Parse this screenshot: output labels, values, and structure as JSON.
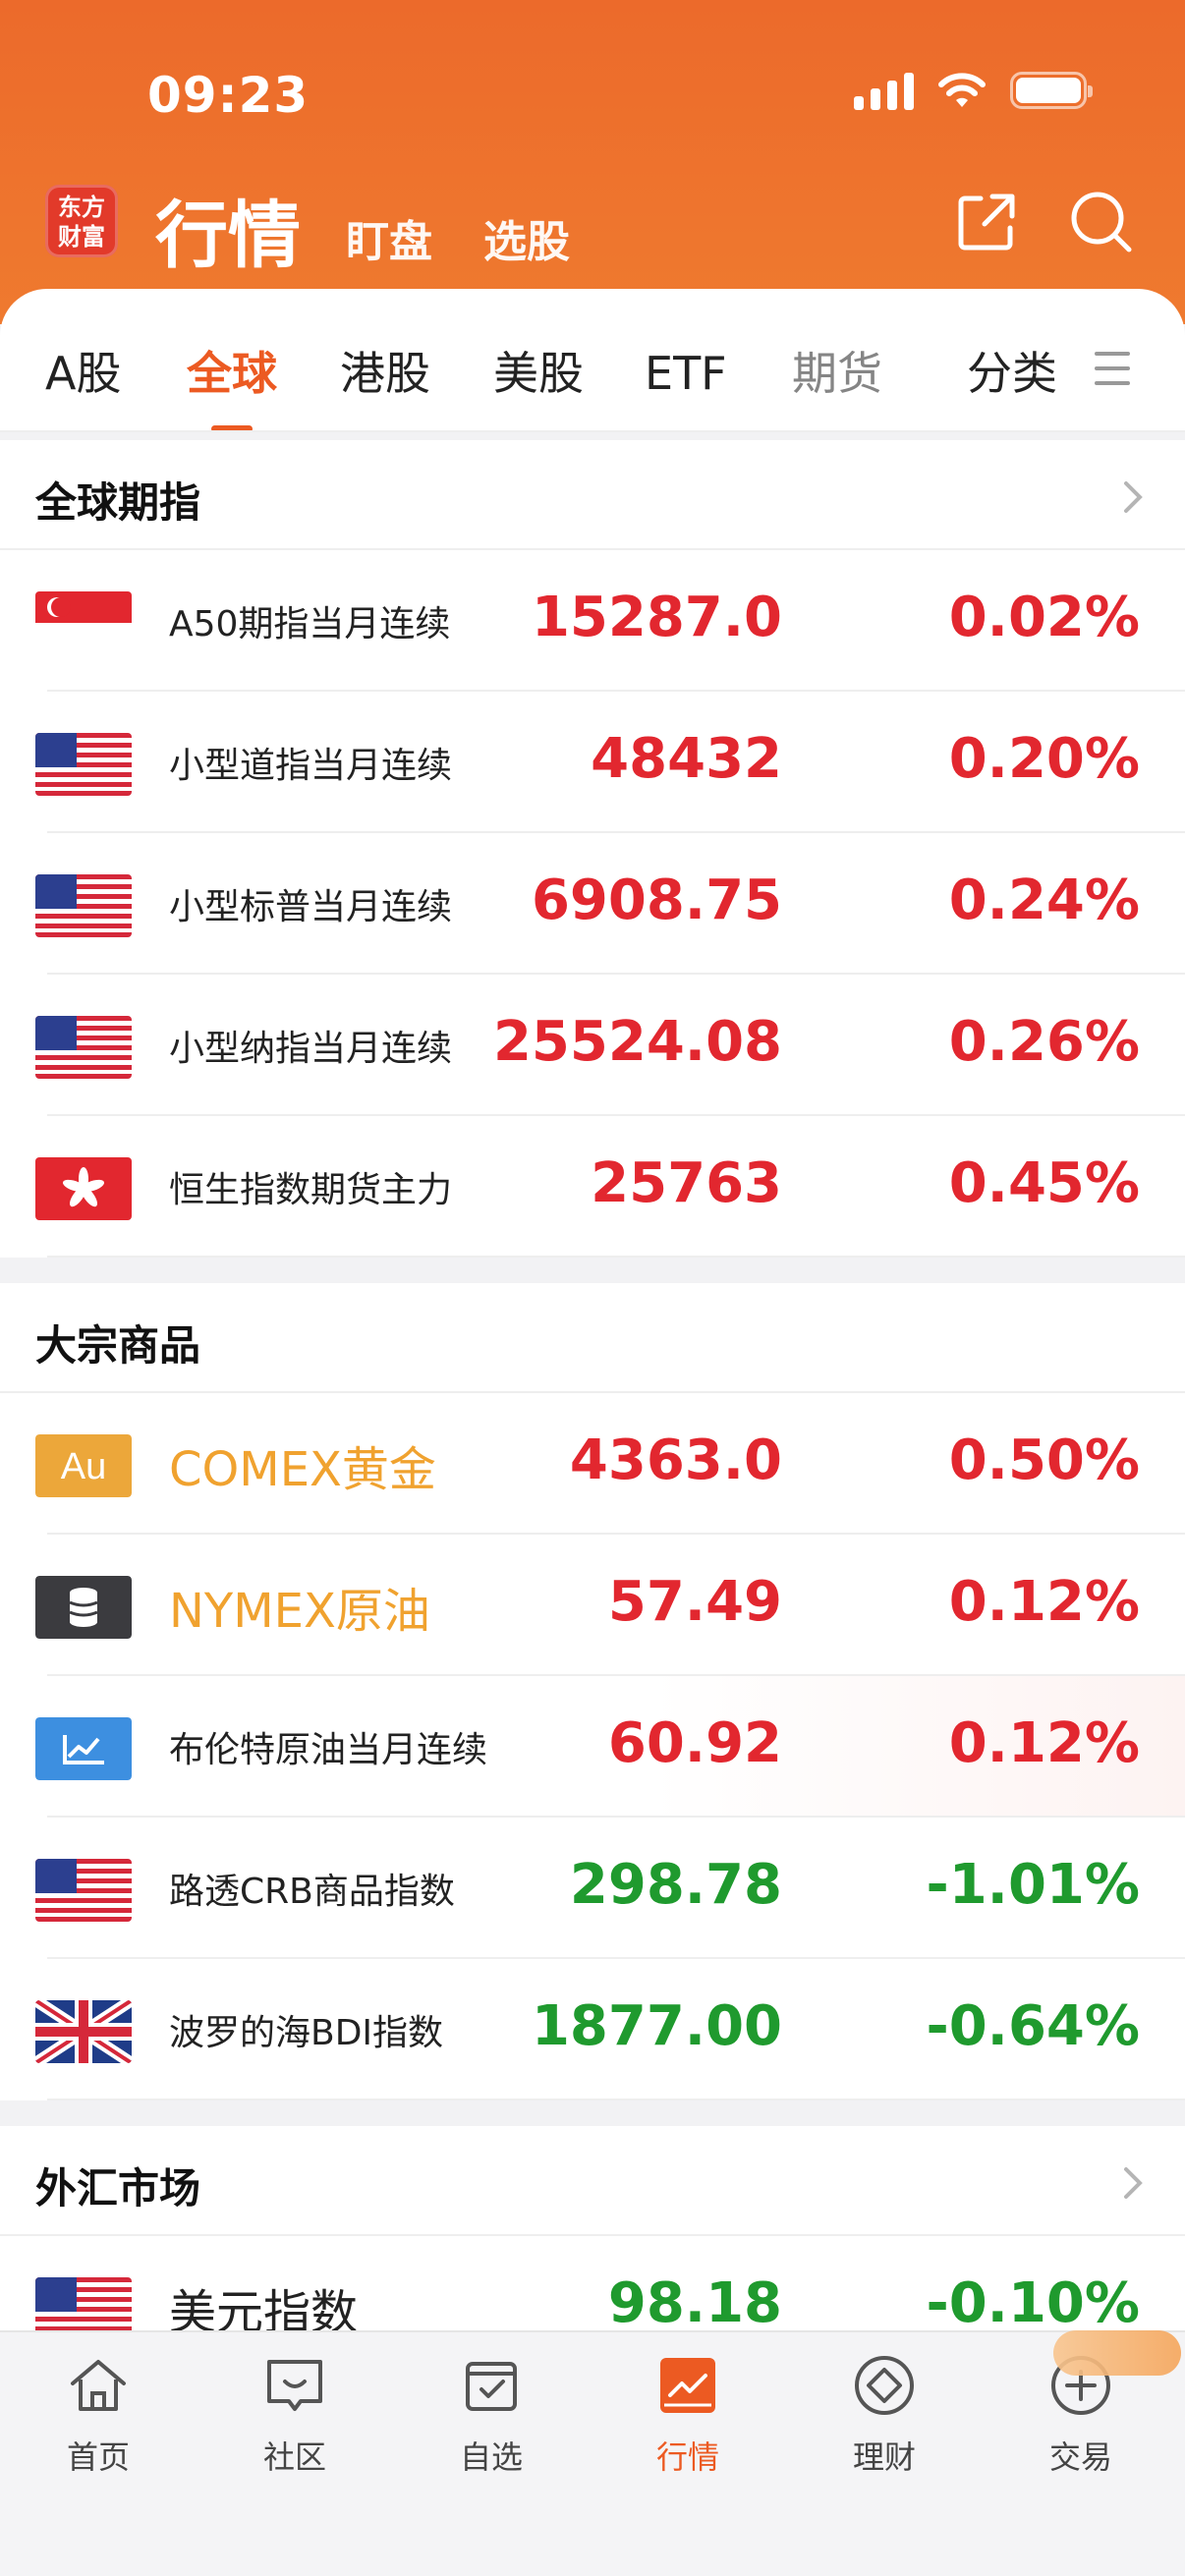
{
  "status_bar": {
    "time": "09:23"
  },
  "header": {
    "logo_text": "东方\n财富",
    "title": "行情",
    "subnav": [
      "盯盘",
      "选股"
    ]
  },
  "tabs": [
    {
      "label": "A股",
      "active": false
    },
    {
      "label": "全球",
      "active": true
    },
    {
      "label": "港股",
      "active": false
    },
    {
      "label": "美股",
      "active": false
    },
    {
      "label": "ETF",
      "active": false
    },
    {
      "label": "期货",
      "active": false
    },
    {
      "label": "分类",
      "active": false
    }
  ],
  "sections": {
    "futures": {
      "title": "全球期指",
      "rows": [
        {
          "icon": "singapore-flag-icon",
          "name": "A50期指当月连续",
          "price": "15287.0",
          "change": "0.02%",
          "direction": "up"
        },
        {
          "icon": "us-flag-icon",
          "name": "小型道指当月连续",
          "price": "48432",
          "change": "0.20%",
          "direction": "up"
        },
        {
          "icon": "us-flag-icon",
          "name": "小型标普当月连续",
          "price": "6908.75",
          "change": "0.24%",
          "direction": "up"
        },
        {
          "icon": "us-flag-icon",
          "name": "小型纳指当月连续",
          "price": "25524.08",
          "change": "0.26%",
          "direction": "up"
        },
        {
          "icon": "hongkong-flag-icon",
          "name": "恒生指数期货主力",
          "price": "25763",
          "change": "0.45%",
          "direction": "up"
        }
      ]
    },
    "commodities": {
      "title": "大宗商品",
      "rows": [
        {
          "icon": "gold-au-icon",
          "name": "COMEX黄金",
          "price": "4363.0",
          "change": "0.50%",
          "direction": "up"
        },
        {
          "icon": "oil-barrel-icon",
          "name": "NYMEX原油",
          "price": "57.49",
          "change": "0.12%",
          "direction": "up"
        },
        {
          "icon": "line-chart-icon",
          "name": "布伦特原油当月连续",
          "price": "60.92",
          "change": "0.12%",
          "direction": "up"
        },
        {
          "icon": "us-flag-icon",
          "name": "路透CRB商品指数",
          "price": "298.78",
          "change": "-1.01%",
          "direction": "down"
        },
        {
          "icon": "uk-flag-icon",
          "name": "波罗的海BDI指数",
          "price": "1877.00",
          "change": "-0.64%",
          "direction": "down"
        }
      ]
    },
    "forex": {
      "title": "外汇市场",
      "rows": [
        {
          "icon": "us-flag-icon",
          "name": "美元指数",
          "price": "98.18",
          "change": "-0.10%",
          "direction": "down"
        }
      ]
    }
  },
  "bottom_nav": [
    {
      "label": "首页",
      "icon": "home-icon"
    },
    {
      "label": "社区",
      "icon": "chat-icon"
    },
    {
      "label": "自选",
      "icon": "watchlist-icon"
    },
    {
      "label": "行情",
      "icon": "market-chart-icon",
      "active": true
    },
    {
      "label": "理财",
      "icon": "diamond-icon"
    },
    {
      "label": "交易",
      "icon": "trade-plus-icon"
    }
  ],
  "colors": {
    "brand": "#ec6a2b",
    "up": "#e2272f",
    "down": "#1f9a2e",
    "gold": "#f0a22f"
  }
}
